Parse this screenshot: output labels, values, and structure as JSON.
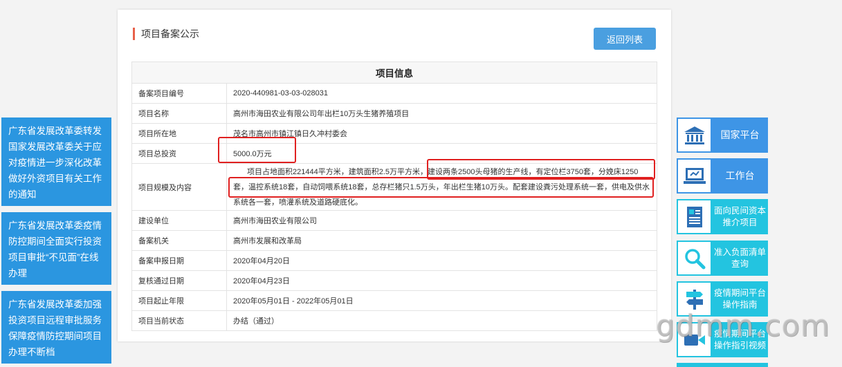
{
  "left_notices": [
    "广东省发展改革委转发国家发展改革委关于应对疫情进一步深化改革做好外资项目有关工作的通知",
    "广东省发展改革委疫情防控期间全面实行投资项目审批“不见面”在线办理",
    "广东省发展改革委加强投资项目远程审批服务保障疫情防控期间项目办理不断档"
  ],
  "panel": {
    "title": "项目备案公示",
    "back_label": "返回列表",
    "table_heading": "项目信息"
  },
  "rows": [
    {
      "label": "备案项目编号",
      "value": "2020-440981-03-03-028031"
    },
    {
      "label": "项目名称",
      "value": "高州市海田农业有限公司年出栏10万头生猪养殖项目"
    },
    {
      "label": "项目所在地",
      "value": "茂名市高州市镇江镇日久冲村委会"
    },
    {
      "label": "项目总投资",
      "value": "5000.0万元"
    },
    {
      "label": "项目规模及内容",
      "value": "项目占地面积221444平方米，建筑面积2.5万平方米，建设两条2500头母猪的生产线，有定位栏3750套，分娩床1250套，温控系统18套，自动饲喂系统18套，总存栏猪只1.5万头，年出栏生猪10万头。配套建设粪污处理系统一套，供电及供水系统各一套，喷灌系统及道路硬底化。"
    },
    {
      "label": "建设单位",
      "value": "高州市海田农业有限公司"
    },
    {
      "label": "备案机关",
      "value": "高州市发展和改革局"
    },
    {
      "label": "备案申报日期",
      "value": "2020年04月20日"
    },
    {
      "label": "复核通过日期",
      "value": "2020年04月23日"
    },
    {
      "label": "项目起止年限",
      "value": "2020年05月01日 - 2022年05月01日"
    },
    {
      "label": "项目当前状态",
      "value": "办结（通过）"
    }
  ],
  "right_sidebar": [
    {
      "label": "国家平台",
      "icon": "government-building-icon"
    },
    {
      "label": "工作台",
      "icon": "computer-icon"
    },
    {
      "label": "面向民间资本推介项目",
      "icon": "document-list-icon"
    },
    {
      "label": "准入负面清单查询",
      "icon": "search-icon"
    },
    {
      "label": "疫情期间平台操作指南",
      "icon": "signpost-icon"
    },
    {
      "label": "疫情期间平台操作指引视频",
      "icon": "video-camera-icon"
    }
  ],
  "watermark": "gdmm.com",
  "colors": {
    "accent_blue": "#2b96e0",
    "cyan": "#23c4e0",
    "highlight_red": "#e02020",
    "title_bar": "#e8614a"
  }
}
